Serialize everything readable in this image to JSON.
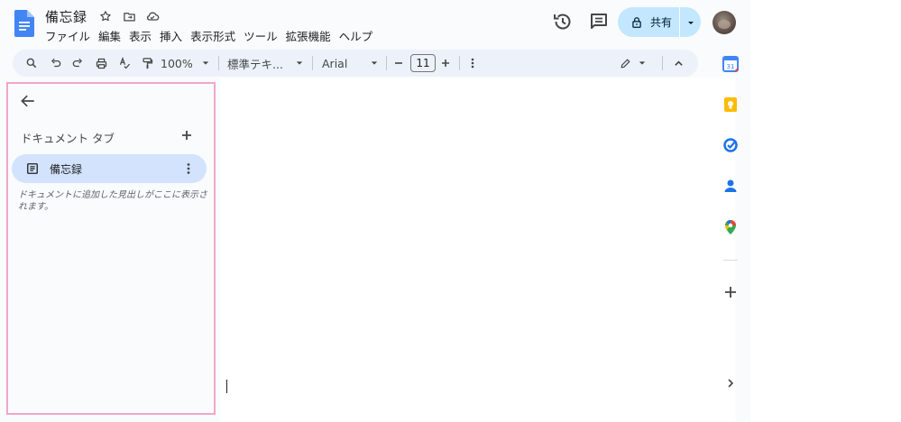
{
  "header": {
    "title": "備忘録",
    "menu": [
      "ファイル",
      "編集",
      "表示",
      "挿入",
      "表示形式",
      "ツール",
      "拡張機能",
      "ヘルプ"
    ],
    "share_label": "共有"
  },
  "toolbar": {
    "zoom": "100%",
    "style": "標準テキ...",
    "font": "Arial",
    "font_size": "11"
  },
  "sidebar": {
    "heading": "ドキュメント タブ",
    "tab_label": "備忘録",
    "hint": "ドキュメントに追加した見出しがここに表示されます。"
  },
  "colors": {
    "accent": "#0b57d0",
    "share_bg": "#c2e7ff",
    "active_tab": "#d3e3fd",
    "highlight_border": "#f2a7c6",
    "toolbar_bg": "#edf2fa"
  },
  "icons": {
    "header": [
      "docs-logo-icon",
      "star-icon",
      "move-folder-icon",
      "cloud-icon",
      "history-icon",
      "comment-icon",
      "lock-icon",
      "chevron-down-icon"
    ],
    "toolbar": [
      "search-icon",
      "undo-icon",
      "redo-icon",
      "print-icon",
      "spellcheck-icon",
      "paint-format-icon",
      "more-vert-icon",
      "edit-pencil-icon",
      "chevron-up-icon"
    ],
    "sidepanel": [
      "calendar-icon",
      "keep-icon",
      "tasks-icon",
      "contacts-icon",
      "maps-icon",
      "add-icon",
      "chevron-right-icon"
    ]
  }
}
